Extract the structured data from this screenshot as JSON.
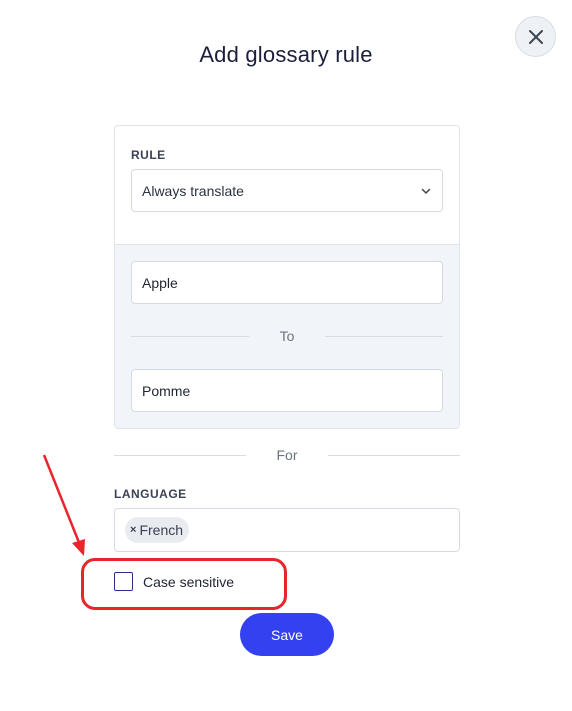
{
  "dialog": {
    "title": "Add glossary rule",
    "close_icon": "close-icon"
  },
  "rule": {
    "label": "RULE",
    "selected": "Always translate",
    "dropdown_icon": "chevron-down-icon"
  },
  "terms": {
    "source": "Apple",
    "separator": "To",
    "target": "Pomme"
  },
  "for_separator": "For",
  "language": {
    "label": "LANGUAGE",
    "chips": [
      "French"
    ],
    "chip_remove": "×"
  },
  "case_sensitive": {
    "label": "Case sensitive",
    "checked": false
  },
  "save_label": "Save",
  "annotation": {
    "color": "#e8252b"
  },
  "colors": {
    "primary": "#3441f0",
    "title": "#1c1f3b",
    "panel_bg": "#f1f4f8"
  }
}
